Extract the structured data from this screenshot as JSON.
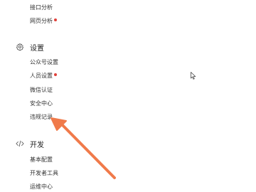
{
  "sidebar": {
    "top_items": [
      {
        "label": "接口分析",
        "dot": false
      },
      {
        "label": "网页分析",
        "dot": true
      }
    ],
    "settings": {
      "title": "设置",
      "icon": "gear-icon",
      "items": [
        {
          "label": "公众号设置",
          "dot": false
        },
        {
          "label": "人员设置",
          "dot": true
        },
        {
          "label": "微信认证",
          "dot": false
        },
        {
          "label": "安全中心",
          "dot": false
        },
        {
          "label": "违规记录",
          "dot": false
        }
      ]
    },
    "dev": {
      "title": "开发",
      "icon": "code-icon",
      "items": [
        {
          "label": "基本配置",
          "dot": false
        },
        {
          "label": "开发者工具",
          "dot": false
        },
        {
          "label": "运维中心",
          "dot": false
        }
      ]
    }
  },
  "colors": {
    "arrow": "#f07a4a",
    "dot": "#e0403a"
  }
}
